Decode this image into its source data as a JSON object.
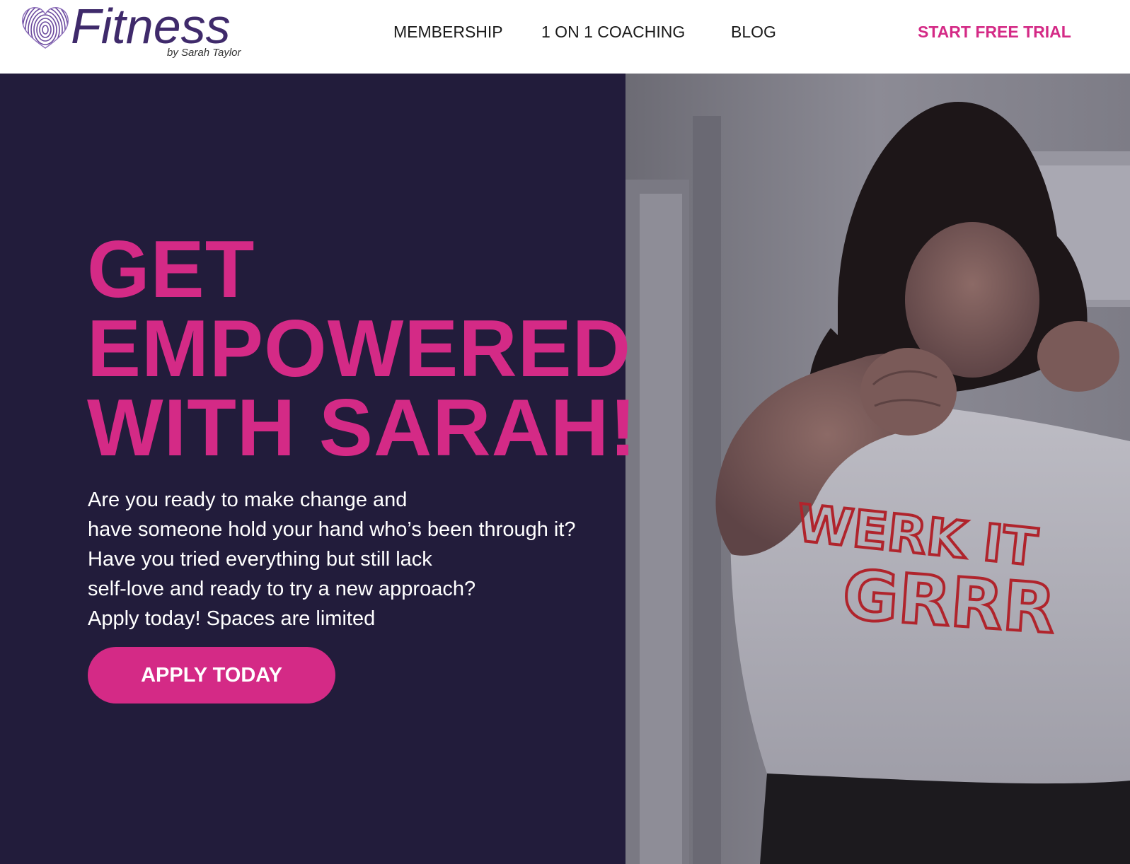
{
  "header": {
    "logo": {
      "wordmark": "Fitness",
      "byline": "by Sarah Taylor",
      "icon": "fingerprint-heart-icon"
    },
    "nav": {
      "membership": "MEMBERSHIP",
      "coaching": "1 ON 1 COACHING",
      "blog": "BLOG"
    },
    "cta": "START FREE TRIAL"
  },
  "hero": {
    "headline": [
      "GET",
      "EMPOWERED",
      "WITH SARAH!"
    ],
    "body": [
      "Are you ready to make change and",
      "have someone hold your hand who’s been through it?",
      "Have you tried everything but still lack",
      "self-love and ready to try a new approach?",
      "Apply today! Spaces are limited"
    ],
    "button": "APPLY TODAY",
    "photo_shirt_text": [
      "WERK IT",
      "GRRR"
    ]
  },
  "colors": {
    "accent": "#d42a86",
    "hero_background": "#221c3b",
    "logo_purple": "#3f2a6b"
  }
}
